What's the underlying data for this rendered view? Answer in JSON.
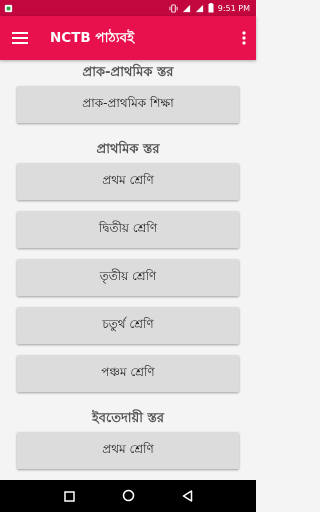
{
  "status": {
    "time": "9:51 PM"
  },
  "appbar": {
    "title": "NCTB পাঠ্যবই"
  },
  "sections": [
    {
      "title": "প্রাক-প্রাথমিক স্তর",
      "buttons": [
        "প্রাক-প্রাথমিক শিক্ষা"
      ]
    },
    {
      "title": "প্রাথমিক স্তর",
      "buttons": [
        "প্রথম শ্রেণি",
        "দ্বিতীয় শ্রেণি",
        "তৃতীয় শ্রেণি",
        "চতুর্থ শ্রেণি",
        "পঞ্চম শ্রেণি"
      ]
    },
    {
      "title": "ইবতেদায়ী স্তর",
      "buttons": [
        "প্রথম শ্রেণি"
      ]
    }
  ],
  "colors": {
    "primary": "#e8114e",
    "status_bar": "#c2073f"
  },
  "icons": {
    "menu": "hamburger-menu-icon",
    "more": "more-vert-icon"
  }
}
